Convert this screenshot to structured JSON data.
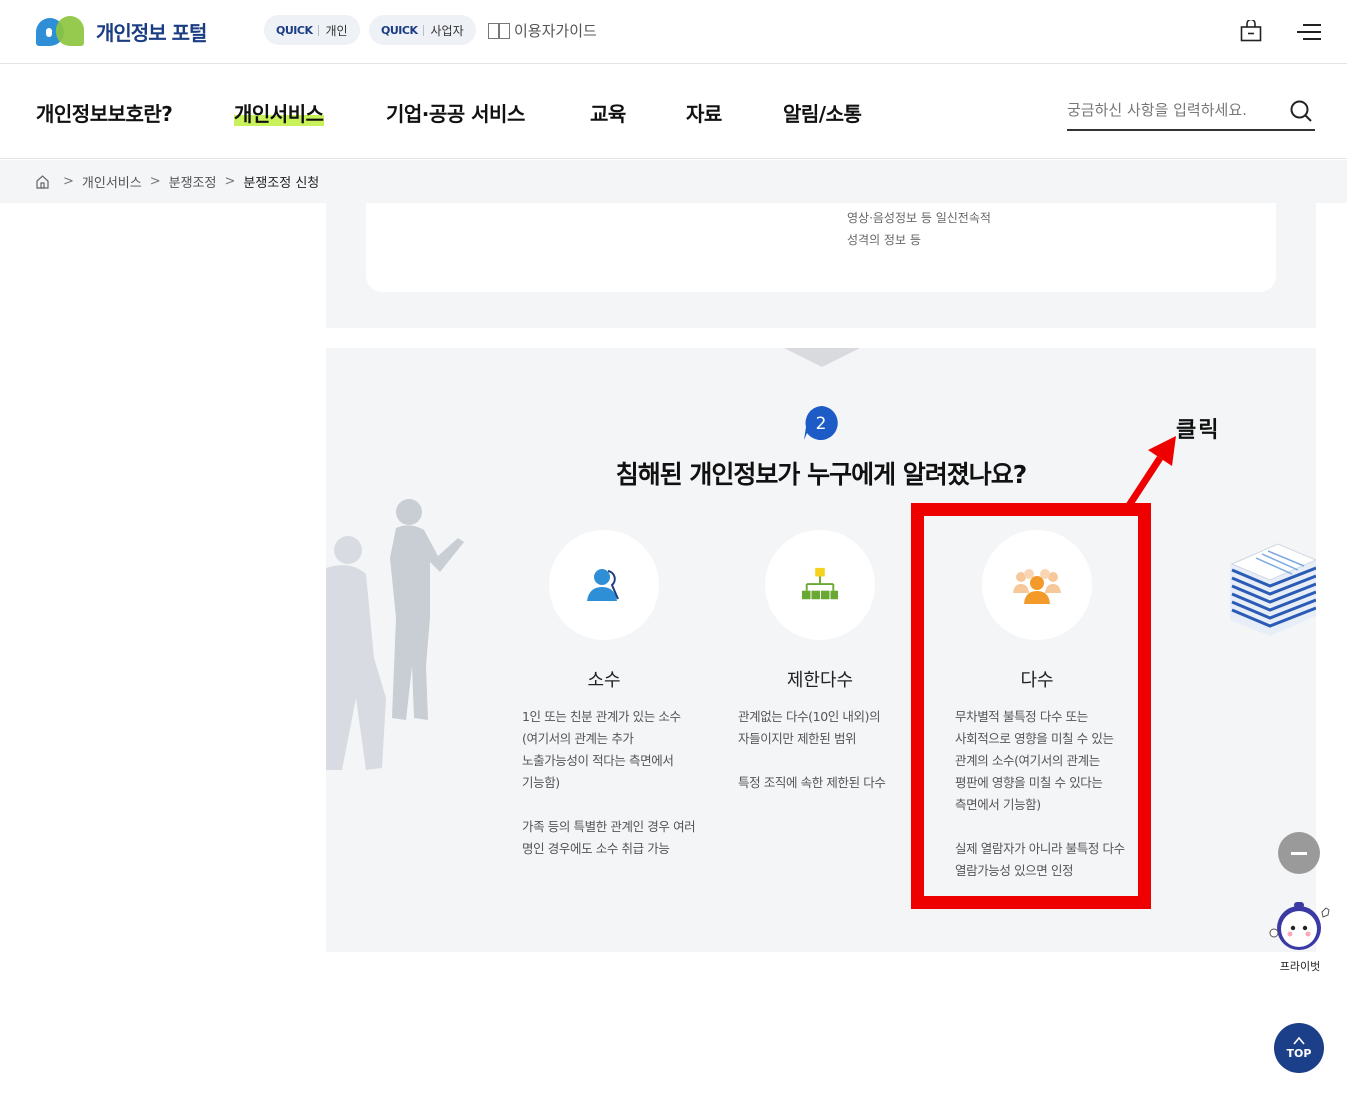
{
  "header": {
    "logo_text": "개인정보 포털",
    "quick_personal": {
      "tag": "QUICK",
      "label": "개인"
    },
    "quick_business": {
      "tag": "QUICK",
      "label": "사업자"
    },
    "guide_label": "이용자가이드"
  },
  "gnb": {
    "items": [
      "개인정보보호란?",
      "개인서비스",
      "기업·공공 서비스",
      "교육",
      "자료",
      "알림/소통"
    ],
    "active_index": 1,
    "search_placeholder": "궁금하신 사항을 입력하세요."
  },
  "breadcrumb": [
    "개인서비스",
    "분쟁조정",
    "분쟁조정 신청"
  ],
  "section1": {
    "lines": [
      "영상·음성정보 등 일신전속적",
      "성격의 정보 등"
    ]
  },
  "section2": {
    "step": "2",
    "question": "침해된 개인정보가 누구에게 알려졌나요?",
    "options": [
      {
        "title": "소수",
        "icon": "single-person-icon",
        "desc1": [
          "1인 또는 친분 관계가 있는 소수",
          "(여기서의 관계는 추가",
          "노출가능성이 적다는 측면에서",
          "기능함)"
        ],
        "desc2": [
          "가족 등의 특별한 관계인 경우 여러",
          "명인 경우에도 소수 취급 가능"
        ]
      },
      {
        "title": "제한다수",
        "icon": "org-chart-icon",
        "desc1": [
          "관계없는 다수(10인 내외)의",
          "자들이지만 제한된 범위"
        ],
        "desc2": [
          "특정 조직에 속한 제한된 다수"
        ]
      },
      {
        "title": "다수",
        "icon": "group-people-icon",
        "desc1": [
          "무차별적 불특정 다수 또는",
          "사회적으로 영향을 미칠 수 있는",
          "관계의 소수(여기서의 관계는",
          "평판에 영향을 미칠 수 있다는",
          "측면에서 기능함)"
        ],
        "desc2": [
          "실제 열람자가 아니라 불특정 다수",
          "열람가능성 있으면 인정"
        ]
      }
    ]
  },
  "annotation": {
    "label": "클릭",
    "color": "#ee0000"
  },
  "floating": {
    "privet_label": "프라이벗",
    "top_label": "TOP"
  },
  "colors": {
    "brand_navy": "#1b3d84",
    "highlight_green": "#c9f25a",
    "badge_blue": "#1d5cc6",
    "icon_blue": "#2f8fd6",
    "icon_green": "#6aa834",
    "icon_orange": "#f39a2b"
  }
}
